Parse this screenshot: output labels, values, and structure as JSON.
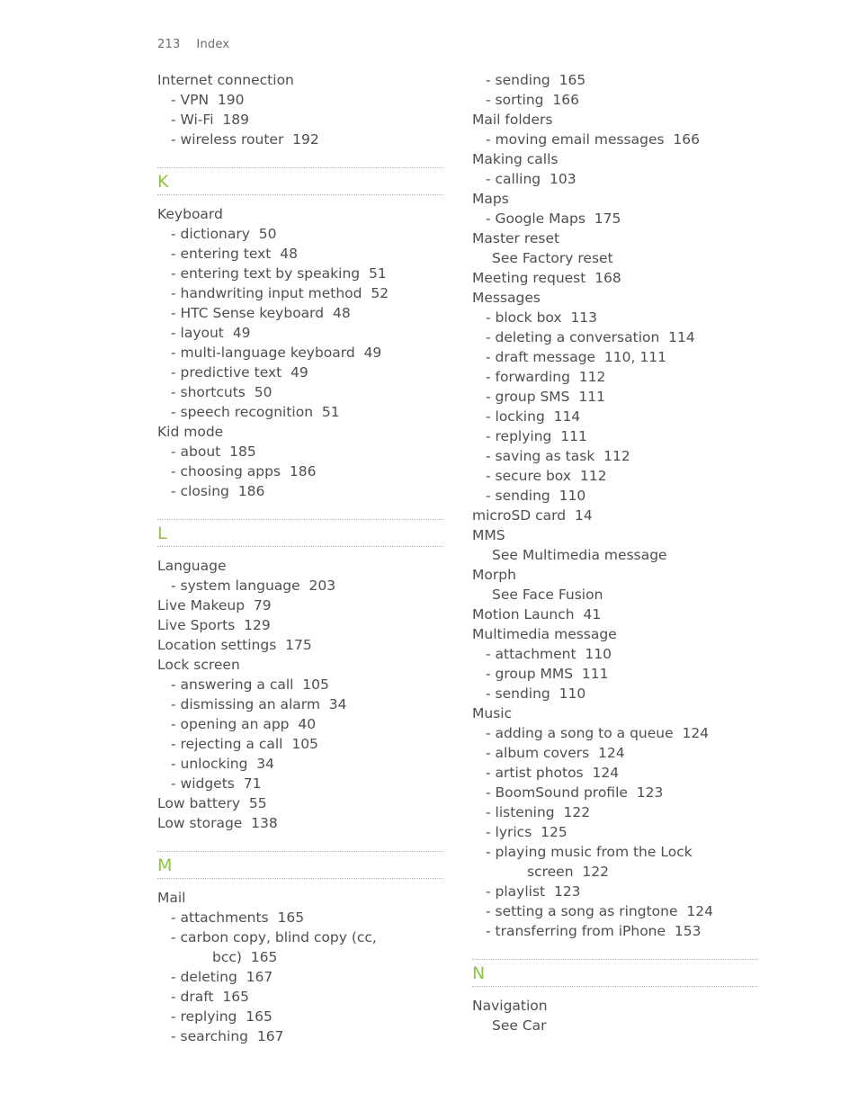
{
  "header": {
    "folio": "213",
    "section_name": "Index"
  },
  "accent_color": "#8cc63e",
  "text_color": "#4f4f4f",
  "rule_color": "#b4b4b4",
  "columns": [
    {
      "name": "left-column",
      "blocks": [
        {
          "type": "entries",
          "entries": [
            {
              "level": 0,
              "text": "Internet connection"
            },
            {
              "level": 1,
              "text": "- VPN  190"
            },
            {
              "level": 1,
              "text": "- Wi-Fi  189"
            },
            {
              "level": 1,
              "text": "- wireless router  192"
            }
          ]
        },
        {
          "type": "letter",
          "letter": "K"
        },
        {
          "type": "entries",
          "entries": [
            {
              "level": 0,
              "text": "Keyboard"
            },
            {
              "level": 1,
              "text": "- dictionary  50"
            },
            {
              "level": 1,
              "text": "- entering text  48"
            },
            {
              "level": 1,
              "text": "- entering text by speaking  51"
            },
            {
              "level": 1,
              "text": "- handwriting input method  52"
            },
            {
              "level": 1,
              "text": "- HTC Sense keyboard  48"
            },
            {
              "level": 1,
              "text": "- layout  49"
            },
            {
              "level": 1,
              "text": "- multi-language keyboard  49"
            },
            {
              "level": 1,
              "text": "- predictive text  49"
            },
            {
              "level": 1,
              "text": "- shortcuts  50"
            },
            {
              "level": 1,
              "text": "- speech recognition  51"
            },
            {
              "level": 0,
              "text": "Kid mode"
            },
            {
              "level": 1,
              "text": "- about  185"
            },
            {
              "level": 1,
              "text": "- choosing apps  186"
            },
            {
              "level": 1,
              "text": "- closing  186"
            }
          ]
        },
        {
          "type": "letter",
          "letter": "L"
        },
        {
          "type": "entries",
          "entries": [
            {
              "level": 0,
              "text": "Language"
            },
            {
              "level": 1,
              "text": "- system language  203"
            },
            {
              "level": 0,
              "text": "Live Makeup  79"
            },
            {
              "level": 0,
              "text": "Live Sports  129"
            },
            {
              "level": 0,
              "text": "Location settings  175"
            },
            {
              "level": 0,
              "text": "Lock screen"
            },
            {
              "level": 1,
              "text": "- answering a call  105"
            },
            {
              "level": 1,
              "text": "- dismissing an alarm  34"
            },
            {
              "level": 1,
              "text": "- opening an app  40"
            },
            {
              "level": 1,
              "text": "- rejecting a call  105"
            },
            {
              "level": 1,
              "text": "- unlocking  34"
            },
            {
              "level": 1,
              "text": "- widgets  71"
            },
            {
              "level": 0,
              "text": "Low battery  55"
            },
            {
              "level": 0,
              "text": "Low storage  138"
            }
          ]
        },
        {
          "type": "letter",
          "letter": "M"
        },
        {
          "type": "entries",
          "entries": [
            {
              "level": 0,
              "text": "Mail"
            },
            {
              "level": 1,
              "text": "- attachments  165"
            },
            {
              "level": 1,
              "text": "- carbon copy, blind copy (cc,",
              "continuation": "bcc)  165"
            },
            {
              "level": 1,
              "text": "- deleting  167"
            },
            {
              "level": 1,
              "text": "- draft  165"
            },
            {
              "level": 1,
              "text": "- replying  165"
            },
            {
              "level": 1,
              "text": "- searching  167"
            }
          ]
        }
      ]
    },
    {
      "name": "right-column",
      "blocks": [
        {
          "type": "entries",
          "entries": [
            {
              "level": 1,
              "text": "- sending  165"
            },
            {
              "level": 1,
              "text": "- sorting  166"
            },
            {
              "level": 0,
              "text": "Mail folders"
            },
            {
              "level": 1,
              "text": "- moving email messages  166"
            },
            {
              "level": 0,
              "text": "Making calls"
            },
            {
              "level": 1,
              "text": "- calling  103"
            },
            {
              "level": 0,
              "text": "Maps"
            },
            {
              "level": 1,
              "text": "- Google Maps  175"
            },
            {
              "level": 0,
              "text": "Master reset"
            },
            {
              "level": 1,
              "text": "See Factory reset",
              "seeref": true
            },
            {
              "level": 0,
              "text": "Meeting request  168"
            },
            {
              "level": 0,
              "text": "Messages"
            },
            {
              "level": 1,
              "text": "- block box  113"
            },
            {
              "level": 1,
              "text": "- deleting a conversation  114"
            },
            {
              "level": 1,
              "text": "- draft message  110, 111"
            },
            {
              "level": 1,
              "text": "- forwarding  112"
            },
            {
              "level": 1,
              "text": "- group SMS  111"
            },
            {
              "level": 1,
              "text": "- locking  114"
            },
            {
              "level": 1,
              "text": "- replying  111"
            },
            {
              "level": 1,
              "text": "- saving as task  112"
            },
            {
              "level": 1,
              "text": "- secure box  112"
            },
            {
              "level": 1,
              "text": "- sending  110"
            },
            {
              "level": 0,
              "text": "microSD card  14"
            },
            {
              "level": 0,
              "text": "MMS"
            },
            {
              "level": 1,
              "text": "See Multimedia message",
              "seeref": true
            },
            {
              "level": 0,
              "text": "Morph"
            },
            {
              "level": 1,
              "text": "See Face Fusion",
              "seeref": true
            },
            {
              "level": 0,
              "text": "Motion Launch  41"
            },
            {
              "level": 0,
              "text": "Multimedia message"
            },
            {
              "level": 1,
              "text": "- attachment  110"
            },
            {
              "level": 1,
              "text": "- group MMS  111"
            },
            {
              "level": 1,
              "text": "- sending  110"
            },
            {
              "level": 0,
              "text": "Music"
            },
            {
              "level": 1,
              "text": "- adding a song to a queue  124"
            },
            {
              "level": 1,
              "text": "- album covers  124"
            },
            {
              "level": 1,
              "text": "- artist photos  124"
            },
            {
              "level": 1,
              "text": "- BoomSound profile  123"
            },
            {
              "level": 1,
              "text": "- listening  122"
            },
            {
              "level": 1,
              "text": "- lyrics  125"
            },
            {
              "level": 1,
              "text": "- playing music from the Lock",
              "continuation": "screen  122"
            },
            {
              "level": 1,
              "text": "- playlist  123"
            },
            {
              "level": 1,
              "text": "- setting a song as ringtone  124"
            },
            {
              "level": 1,
              "text": "- transferring from iPhone  153"
            }
          ]
        },
        {
          "type": "letter",
          "letter": "N"
        },
        {
          "type": "entries",
          "entries": [
            {
              "level": 0,
              "text": "Navigation"
            },
            {
              "level": 1,
              "text": "See Car",
              "seeref": true
            }
          ]
        }
      ]
    }
  ]
}
